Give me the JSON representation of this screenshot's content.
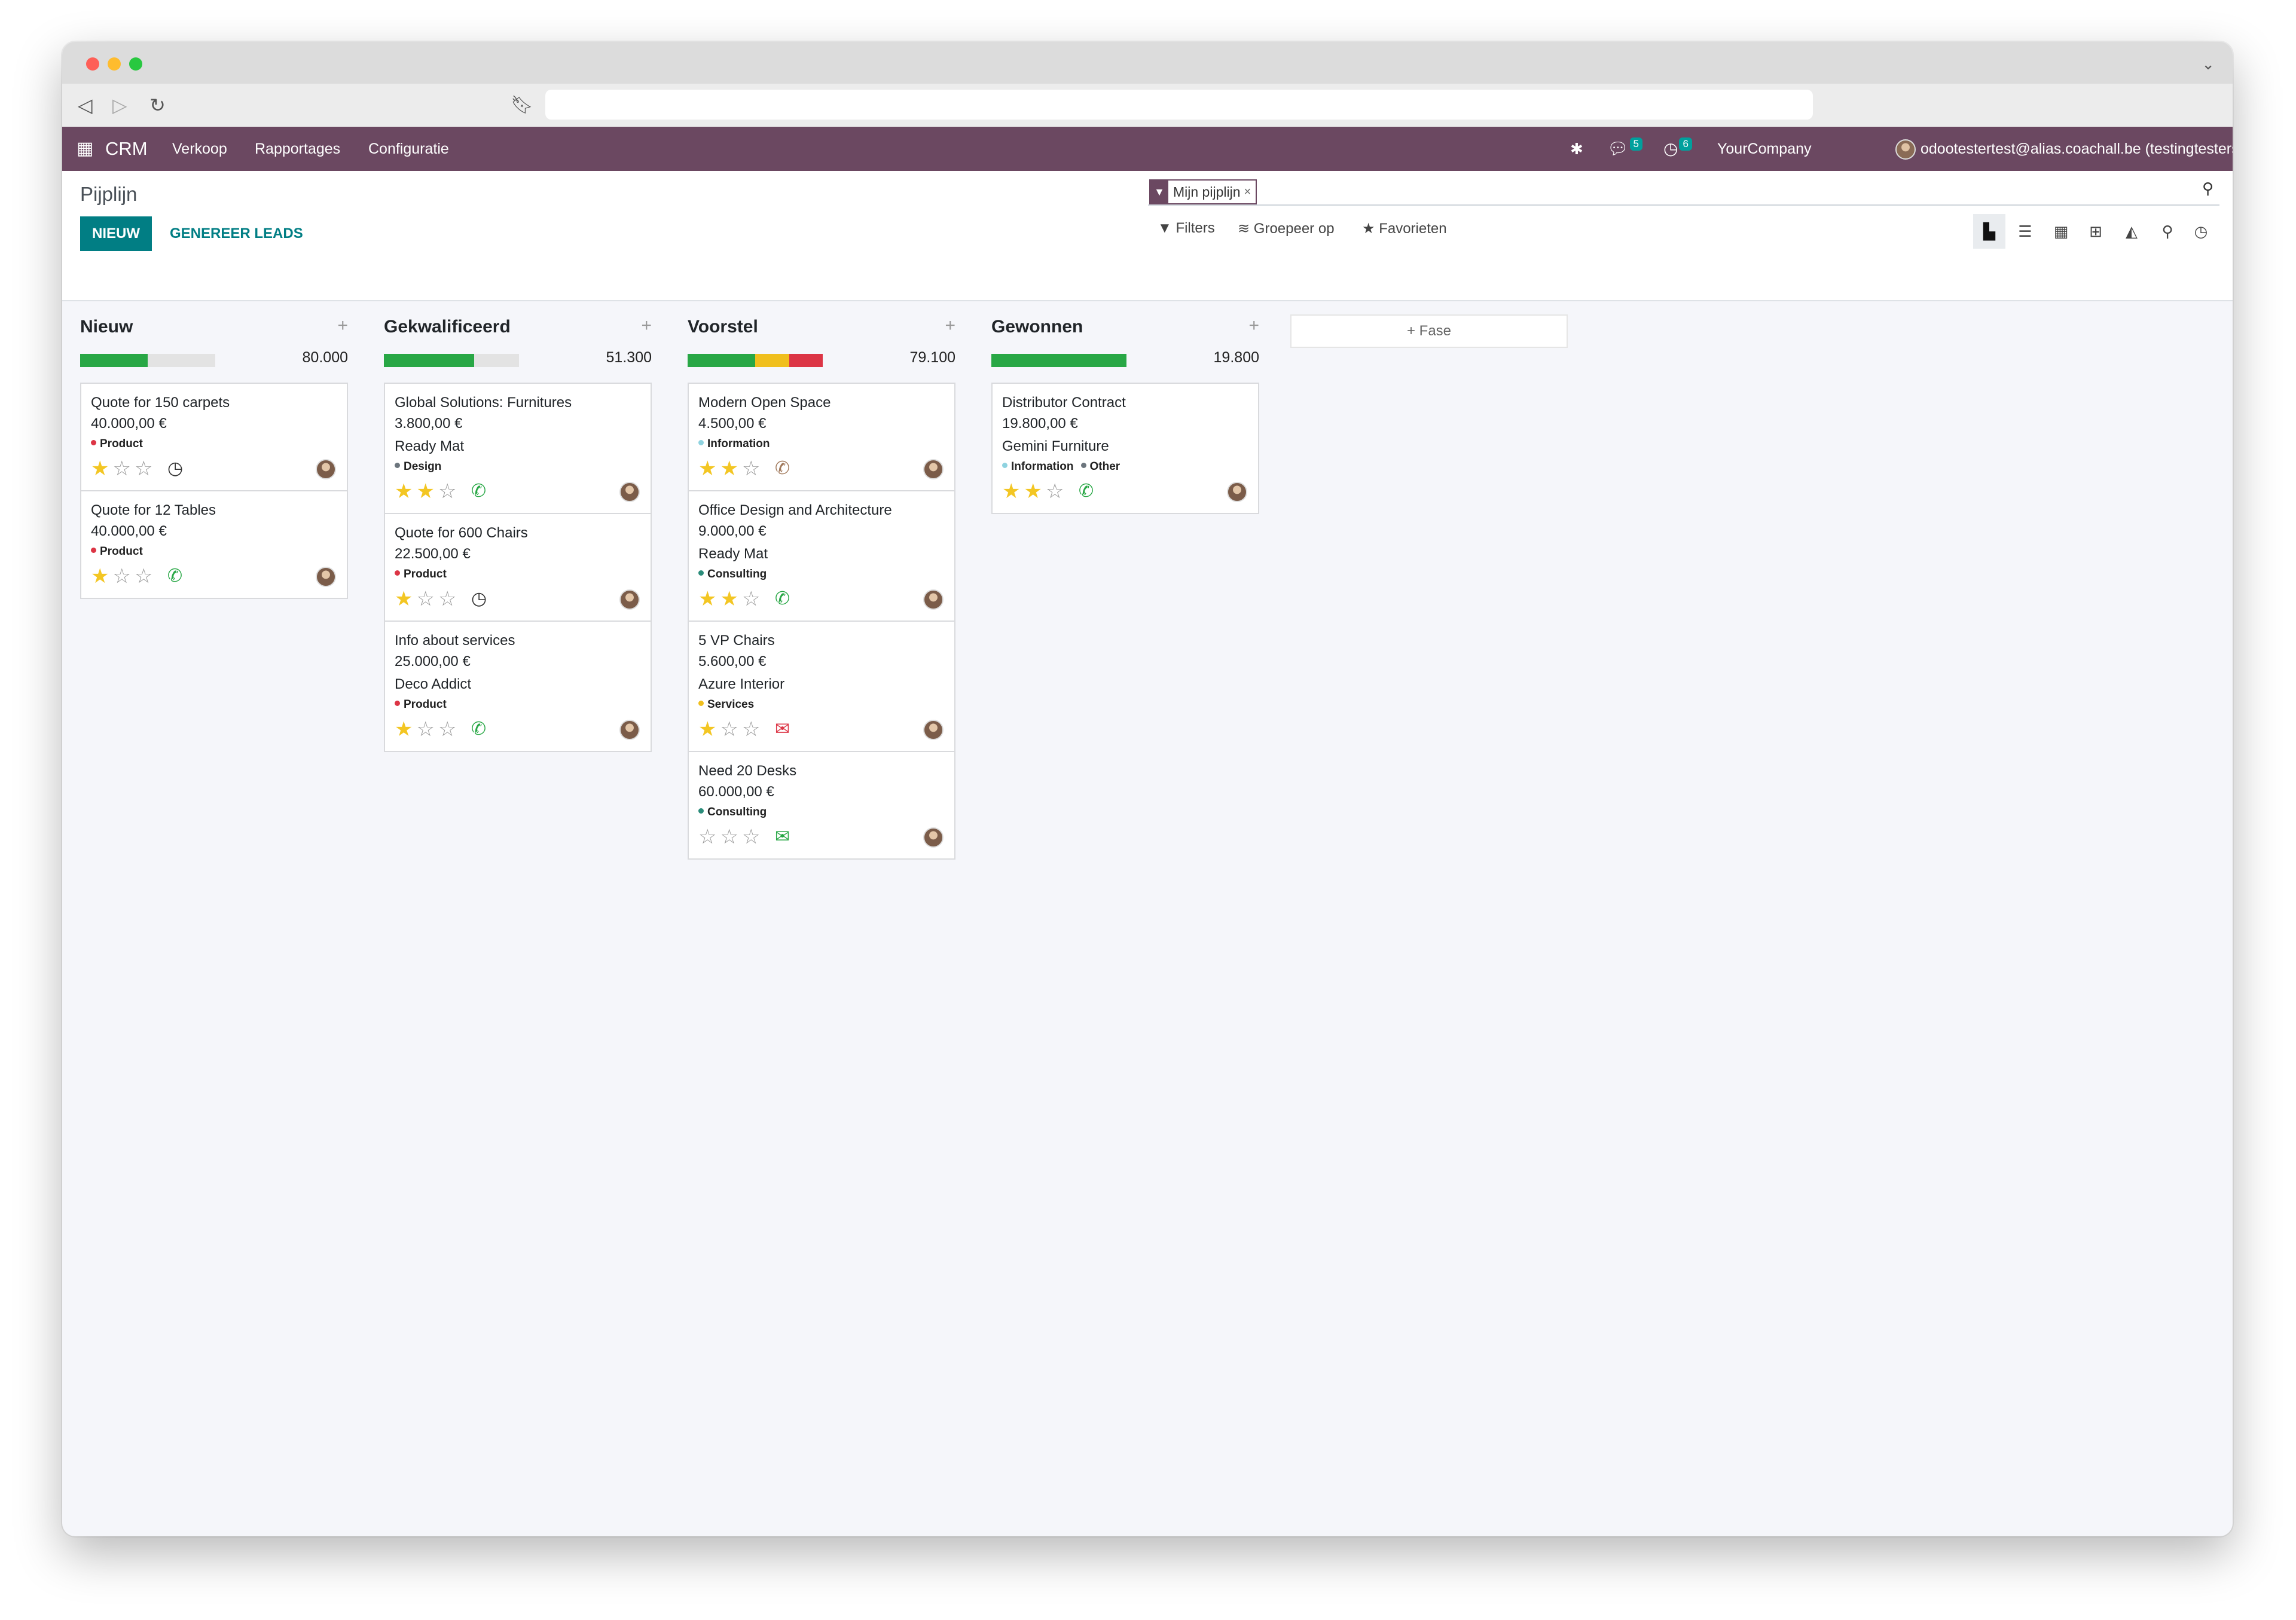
{
  "browser": {},
  "navbar": {
    "app_name": "CRM",
    "menus": [
      "Verkoop",
      "Rapportages",
      "Configuratie"
    ],
    "messages_count": "5",
    "activities_count": "6",
    "company": "YourCompany",
    "user": "odootestertest@alias.coachall.be (testingtesterstest)"
  },
  "control_panel": {
    "breadcrumb": "Pijplijn",
    "new_button": "NIEUW",
    "generate_button": "GENEREER LEADS",
    "facet_label": "Mijn pijplijn",
    "facet_remove": "×",
    "filters_label": "Filters",
    "groupby_label": "Groepeer op",
    "favorites_label": "Favorieten",
    "views": [
      "kanban",
      "list",
      "calendar",
      "pivot",
      "graph",
      "map",
      "activity"
    ],
    "active_view": "kanban"
  },
  "colors": {
    "navbar": "#6b4861",
    "primary": "#017e84",
    "green": "#28a745",
    "yellow": "#f0bf1d",
    "red": "#dc3545",
    "star": "#f3c623"
  },
  "kanban": {
    "add_stage_label": "Fase",
    "columns": [
      {
        "title": "Nieuw",
        "total": "80.000",
        "progress": [
          {
            "color": "#28a745",
            "fraction": 0.5
          }
        ],
        "cards": [
          {
            "title": "Quote for 150 carpets",
            "amount": "40.000,00 €",
            "customer": "",
            "tags": [
              {
                "label": "Product",
                "color": "#dc3545"
              }
            ],
            "stars": 1,
            "activity": "clock"
          },
          {
            "title": "Quote for 12 Tables",
            "amount": "40.000,00 €",
            "customer": "",
            "tags": [
              {
                "label": "Product",
                "color": "#dc3545"
              }
            ],
            "stars": 1,
            "activity": "phone-green"
          }
        ]
      },
      {
        "title": "Gekwalificeerd",
        "total": "51.300",
        "progress": [
          {
            "color": "#28a745",
            "fraction": 0.67
          }
        ],
        "cards": [
          {
            "title": "Global Solutions: Furnitures",
            "amount": "3.800,00 €",
            "customer": "Ready Mat",
            "tags": [
              {
                "label": "Design",
                "color": "#6c757d"
              }
            ],
            "stars": 2,
            "activity": "phone-green"
          },
          {
            "title": "Quote for 600 Chairs",
            "amount": "22.500,00 €",
            "customer": "",
            "tags": [
              {
                "label": "Product",
                "color": "#dc3545"
              }
            ],
            "stars": 1,
            "activity": "clock"
          },
          {
            "title": "Info about services",
            "amount": "25.000,00 €",
            "customer": "Deco Addict",
            "tags": [
              {
                "label": "Product",
                "color": "#dc3545"
              }
            ],
            "stars": 1,
            "activity": "phone-green"
          }
        ]
      },
      {
        "title": "Voorstel",
        "total": "79.100",
        "progress": [
          {
            "color": "#28a745",
            "fraction": 0.5
          },
          {
            "color": "#f0bf1d",
            "fraction": 0.25
          },
          {
            "color": "#dc3545",
            "fraction": 0.25
          }
        ],
        "cards": [
          {
            "title": "Modern Open Space",
            "amount": "4.500,00 €",
            "customer": "",
            "tags": [
              {
                "label": "Information",
                "color": "#8fd3e0"
              }
            ],
            "stars": 2,
            "activity": "phone-brown"
          },
          {
            "title": "Office Design and Architecture",
            "amount": "9.000,00 €",
            "customer": "Ready Mat",
            "tags": [
              {
                "label": "Consulting",
                "color": "#2a8c7a"
              }
            ],
            "stars": 2,
            "activity": "phone-green"
          },
          {
            "title": "5 VP Chairs",
            "amount": "5.600,00 €",
            "customer": "Azure Interior",
            "tags": [
              {
                "label": "Services",
                "color": "#f0bf1d"
              }
            ],
            "stars": 1,
            "activity": "mail-red"
          },
          {
            "title": "Need 20 Desks",
            "amount": "60.000,00 €",
            "customer": "",
            "tags": [
              {
                "label": "Consulting",
                "color": "#2a8c7a"
              }
            ],
            "stars": 0,
            "activity": "mail-green"
          }
        ]
      },
      {
        "title": "Gewonnen",
        "total": "19.800",
        "progress": [
          {
            "color": "#28a745",
            "fraction": 1.0
          }
        ],
        "cards": [
          {
            "title": "Distributor Contract",
            "amount": "19.800,00 €",
            "customer": "Gemini Furniture",
            "tags": [
              {
                "label": "Information",
                "color": "#8fd3e0"
              },
              {
                "label": "Other",
                "color": "#6c757d"
              }
            ],
            "stars": 2,
            "activity": "phone-green"
          }
        ]
      }
    ]
  }
}
